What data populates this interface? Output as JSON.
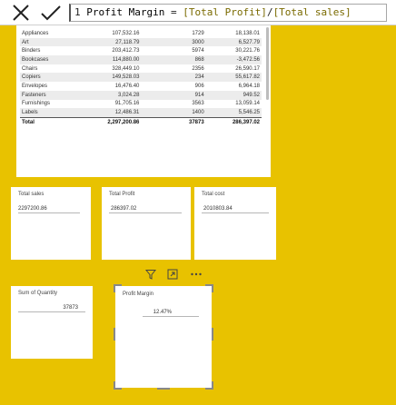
{
  "formula_bar": {
    "line_number": "1",
    "measure_name": "Profit Margin",
    "operator": " = ",
    "expr_numerator": "[Total Profit]",
    "expr_slash": "/",
    "expr_denominator": "[Total sales]"
  },
  "table": {
    "rows": [
      {
        "name": "Appliances",
        "sales": "107,532.16",
        "qty": "1729",
        "profit": "18,138.01"
      },
      {
        "name": "Art",
        "sales": "27,118.79",
        "qty": "3000",
        "profit": "6,527.79"
      },
      {
        "name": "Binders",
        "sales": "203,412.73",
        "qty": "5974",
        "profit": "30,221.76"
      },
      {
        "name": "Bookcases",
        "sales": "114,880.00",
        "qty": "868",
        "profit": "-3,472.56"
      },
      {
        "name": "Chairs",
        "sales": "328,449.10",
        "qty": "2356",
        "profit": "26,590.17"
      },
      {
        "name": "Copiers",
        "sales": "149,528.03",
        "qty": "234",
        "profit": "55,617.82"
      },
      {
        "name": "Envelopes",
        "sales": "16,476.40",
        "qty": "906",
        "profit": "6,964.18"
      },
      {
        "name": "Fasteners",
        "sales": "3,024.28",
        "qty": "914",
        "profit": "949.52"
      },
      {
        "name": "Furnishings",
        "sales": "91,705.16",
        "qty": "3563",
        "profit": "13,059.14"
      },
      {
        "name": "Labels",
        "sales": "12,486.31",
        "qty": "1400",
        "profit": "5,546.25"
      }
    ],
    "total": {
      "name": "Total",
      "sales": "2,297,200.86",
      "qty": "37873",
      "profit": "286,397.02"
    }
  },
  "cards": {
    "total_sales": {
      "title": "Total sales",
      "value": "2297200.86"
    },
    "total_profit": {
      "title": "Total Profit",
      "value": "286397.02"
    },
    "total_cost": {
      "title": "Total cost",
      "value": "2010803.84"
    },
    "sum_quantity": {
      "title": "Sum of Quantity",
      "value": "37873"
    },
    "profit_margin": {
      "title": "Profit Margin",
      "value": "12.47%"
    }
  },
  "colors": {
    "canvas": "#e8c200",
    "visual_bg": "#ffffff",
    "alt_row": "#ececec"
  },
  "icons": [
    "close-icon",
    "check-icon",
    "filter-icon",
    "focus-mode-icon",
    "more-options-icon"
  ]
}
